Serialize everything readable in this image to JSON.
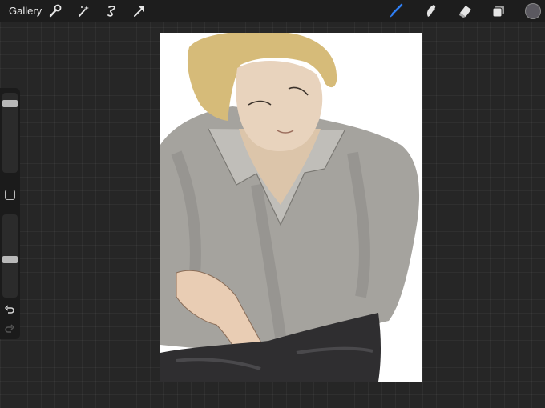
{
  "toolbar": {
    "gallery_label": "Gallery",
    "left_tools": [
      "wrench-icon",
      "magic-wand-icon",
      "selection-icon",
      "transform-arrow-icon"
    ],
    "right_tools": [
      "brush-icon",
      "smudge-icon",
      "eraser-icon",
      "layers-icon"
    ],
    "active_tool": "brush-icon",
    "active_color": "#5b5960",
    "accent_color": "#2f7ff5"
  },
  "sidebar": {
    "brush_size": 0.9,
    "opacity": 0.45
  }
}
